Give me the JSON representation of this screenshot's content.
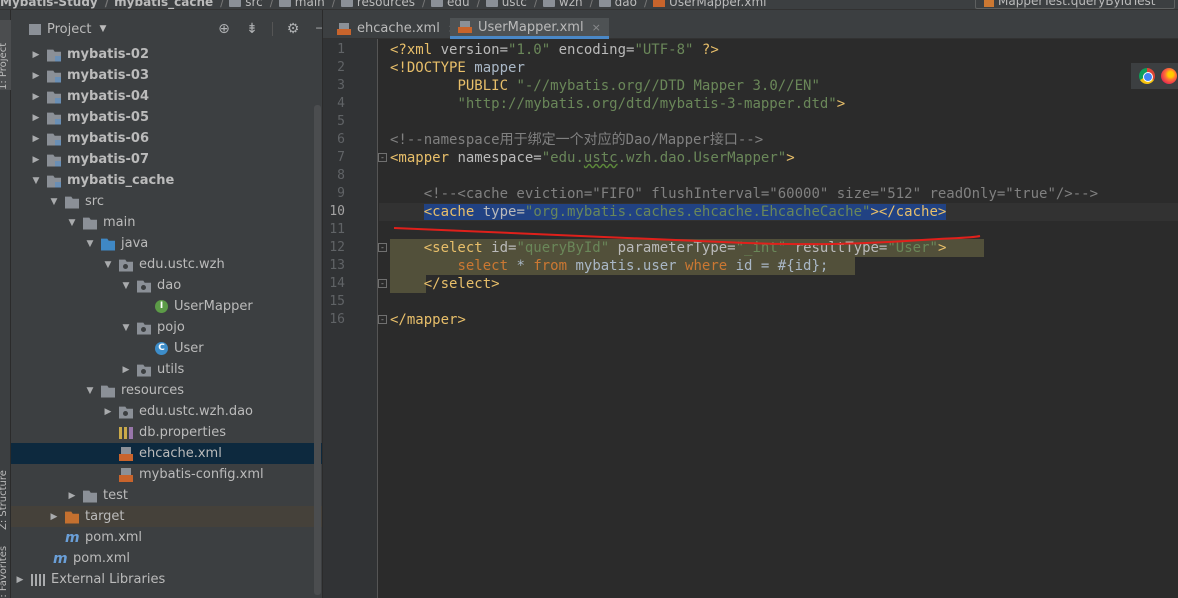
{
  "breadcrumbs": [
    "Mybatis-Study",
    "mybatis_cache",
    "src",
    "main",
    "resources",
    "edu",
    "ustc",
    "wzh",
    "dao",
    "UserMapper.xml"
  ],
  "run_config": "MapperTest.queryByIdTest",
  "side_strips": {
    "project": "1: Project",
    "structure": "Z: Structure",
    "favorites": "2: Favorites"
  },
  "project_panel": {
    "title": "Project",
    "icons": [
      "crosshair-icon",
      "collapse-icon",
      "gear-icon",
      "hide-icon"
    ]
  },
  "tree": [
    {
      "label": "mybatis-02",
      "depth": 0,
      "icon": "module",
      "arrow": "collapsed",
      "bold": true
    },
    {
      "label": "mybatis-03",
      "depth": 0,
      "icon": "module",
      "arrow": "collapsed",
      "bold": true
    },
    {
      "label": "mybatis-04",
      "depth": 0,
      "icon": "module",
      "arrow": "collapsed",
      "bold": true
    },
    {
      "label": "mybatis-05",
      "depth": 0,
      "icon": "module",
      "arrow": "collapsed",
      "bold": true
    },
    {
      "label": "mybatis-06",
      "depth": 0,
      "icon": "module",
      "arrow": "collapsed",
      "bold": true
    },
    {
      "label": "mybatis-07",
      "depth": 0,
      "icon": "module",
      "arrow": "collapsed",
      "bold": true
    },
    {
      "label": "mybatis_cache",
      "depth": 0,
      "icon": "module",
      "arrow": "expanded",
      "bold": true
    },
    {
      "label": "src",
      "depth": 1,
      "icon": "folder",
      "arrow": "expanded"
    },
    {
      "label": "main",
      "depth": 2,
      "icon": "folder",
      "arrow": "expanded"
    },
    {
      "label": "java",
      "depth": 3,
      "icon": "folder-blue",
      "arrow": "expanded"
    },
    {
      "label": "edu.ustc.wzh",
      "depth": 4,
      "icon": "pkg",
      "arrow": "expanded"
    },
    {
      "label": "dao",
      "depth": 5,
      "icon": "pkg",
      "arrow": "expanded"
    },
    {
      "label": "UserMapper",
      "depth": 6,
      "icon": "interface",
      "arrow": "none"
    },
    {
      "label": "pojo",
      "depth": 5,
      "icon": "pkg",
      "arrow": "expanded"
    },
    {
      "label": "User",
      "depth": 6,
      "icon": "klass",
      "arrow": "none"
    },
    {
      "label": "utils",
      "depth": 5,
      "icon": "pkg",
      "arrow": "collapsed"
    },
    {
      "label": "resources",
      "depth": 3,
      "icon": "folder-res",
      "arrow": "expanded"
    },
    {
      "label": "edu.ustc.wzh.dao",
      "depth": 4,
      "icon": "pkg",
      "arrow": "collapsed"
    },
    {
      "label": "db.properties",
      "depth": 4,
      "icon": "props",
      "arrow": "none"
    },
    {
      "label": "ehcache.xml",
      "depth": 4,
      "icon": "xml",
      "arrow": "none",
      "selected": true
    },
    {
      "label": "mybatis-config.xml",
      "depth": 4,
      "icon": "xml",
      "arrow": "none"
    },
    {
      "label": "test",
      "depth": 2,
      "icon": "folder",
      "arrow": "collapsed"
    },
    {
      "label": "target",
      "depth": 1,
      "icon": "folder-target",
      "arrow": "collapsed",
      "excluded": true
    },
    {
      "label": "pom.xml",
      "depth": 1,
      "icon": "maven",
      "arrow": "none"
    },
    {
      "label": "pom.xml",
      "depth": 0,
      "icon": "maven",
      "arrow": "none",
      "flush": true
    },
    {
      "label": "External Libraries",
      "depth": -1,
      "icon": "libs",
      "arrow": "collapsed"
    }
  ],
  "tabs": [
    {
      "label": "ehcache.xml",
      "active": false
    },
    {
      "label": "UserMapper.xml",
      "active": true
    }
  ],
  "close_glyph": "×",
  "editor": {
    "current_line": 10,
    "lines": [
      [
        [
          "t-tag",
          "<?xml "
        ],
        [
          "t-attr",
          "version="
        ],
        [
          "t-val",
          "\"1.0\" "
        ],
        [
          "t-attr",
          "encoding="
        ],
        [
          "t-val",
          "\"UTF-8\" "
        ],
        [
          "t-tag",
          "?>"
        ]
      ],
      [
        [
          "t-tag",
          "<!DOCTYPE "
        ],
        [
          "t-text",
          "mapper"
        ]
      ],
      [
        [
          "t-text",
          "        "
        ],
        [
          "t-tag",
          "PUBLIC "
        ],
        [
          "t-val",
          "\"-//mybatis.org//DTD Mapper 3.0//EN\""
        ]
      ],
      [
        [
          "t-text",
          "        "
        ],
        [
          "t-val",
          "\"http://mybatis.org/dtd/mybatis-3-mapper.dtd\""
        ],
        [
          "t-tag",
          ">"
        ]
      ],
      [],
      [
        [
          "t-cmt",
          "<!--namespace用于绑定一个对应的Dao/Mapper接口-->"
        ]
      ],
      [
        [
          "t-tag",
          "<mapper "
        ],
        [
          "t-attr",
          "namespace="
        ],
        [
          "t-val",
          "\"edu."
        ],
        [
          "t-val ul-green",
          "ustc"
        ],
        [
          "t-val",
          ".wzh.dao.UserMapper\""
        ],
        [
          "t-tag",
          ">"
        ]
      ],
      [],
      [
        [
          "t-text",
          "    "
        ],
        [
          "t-cmt",
          "<!--<cache eviction=\"FIFO\" flushInterval=\"60000\" size=\"512\" readOnly=\"true\"/>-->"
        ]
      ],
      [
        [
          "t-text",
          "    "
        ],
        [
          "t-tag sel",
          "<cache "
        ],
        [
          "t-attr sel",
          "type="
        ],
        [
          "t-val sel",
          "\"org.mybatis.caches.ehcache.EhcacheCache\""
        ],
        [
          "t-tag sel",
          "></cache>"
        ]
      ],
      [],
      [
        [
          "t-text",
          "    "
        ],
        [
          "t-tag",
          "<select "
        ],
        [
          "t-attr",
          "id="
        ],
        [
          "t-val",
          "\"queryById\" "
        ],
        [
          "t-attr",
          "parameterType="
        ],
        [
          "t-val",
          "\"_int\" "
        ],
        [
          "t-attr",
          "resultType="
        ],
        [
          "t-val",
          "\"User\""
        ],
        [
          "t-tag",
          ">"
        ]
      ],
      [
        [
          "t-text",
          "        "
        ],
        [
          "t-kw",
          "select "
        ],
        [
          "t-text",
          "* "
        ],
        [
          "t-kw",
          "from "
        ],
        [
          "t-text",
          "mybatis.user "
        ],
        [
          "t-kw",
          "where "
        ],
        [
          "t-text",
          "id = #{id};"
        ]
      ],
      [
        [
          "t-text",
          "    "
        ],
        [
          "t-tag",
          "</select>"
        ]
      ],
      [],
      [
        [
          "t-tag",
          "</mapper>"
        ]
      ]
    ]
  },
  "browsers": [
    "chrome-icon",
    "firefox-icon"
  ],
  "annotation_color": "#e0201b"
}
